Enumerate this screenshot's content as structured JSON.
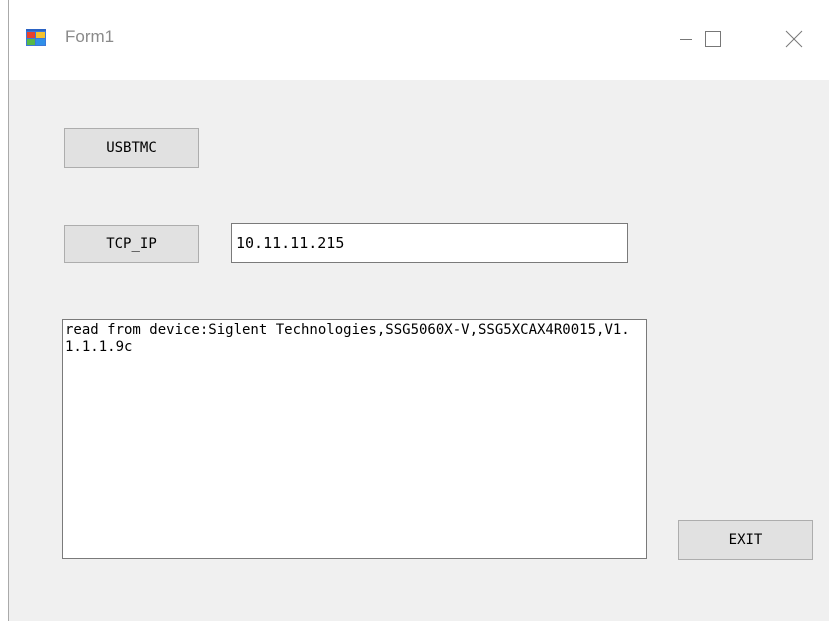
{
  "window": {
    "title": "Form1",
    "icon": "winforms-app-icon"
  },
  "titlebar_buttons": {
    "minimize": "minimize-icon",
    "maximize": "maximize-icon",
    "close": "close-icon"
  },
  "buttons": {
    "usbtmc": "USBTMC",
    "tcp_ip": "TCP_IP",
    "exit": "EXIT"
  },
  "ip_address": {
    "value": "10.11.11.215"
  },
  "output": {
    "text": "read from device:Siglent Technologies,SSG5060X-V,SSG5XCAX4R0015,V1.1.1.1.9c"
  }
}
